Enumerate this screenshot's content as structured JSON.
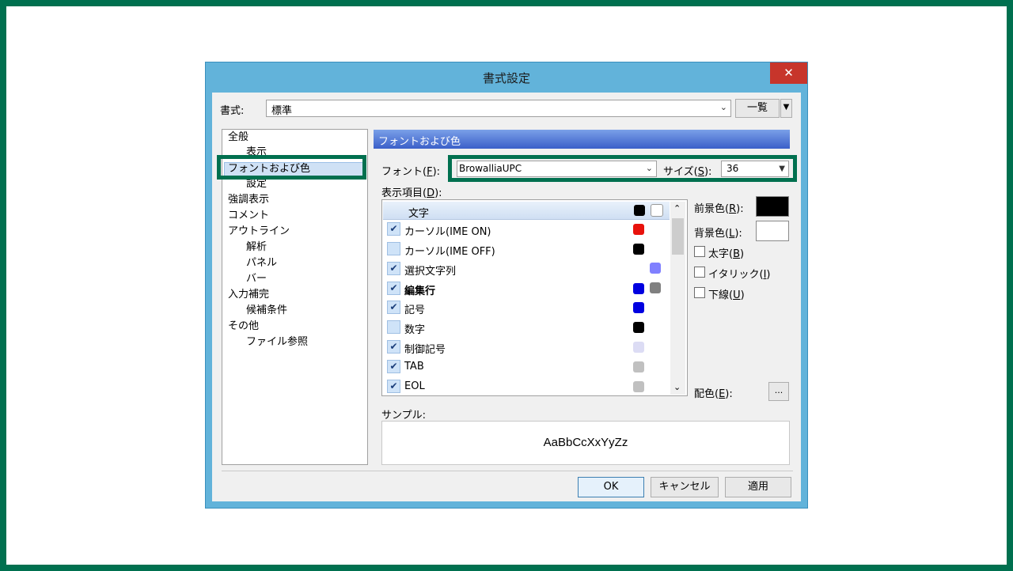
{
  "dialog": {
    "title": "書式設定",
    "close_glyph": "✕",
    "format_label": "書式:",
    "format_value": "標準",
    "list_button": "一覧",
    "tree": [
      {
        "label": "全般",
        "indent": 0
      },
      {
        "label": "表示",
        "indent": 1
      },
      {
        "label": "フォントおよび色",
        "indent": 0,
        "selected": true
      },
      {
        "label": "設定",
        "indent": 1
      },
      {
        "label": "強調表示",
        "indent": 0
      },
      {
        "label": "コメント",
        "indent": 0
      },
      {
        "label": "アウトライン",
        "indent": 0
      },
      {
        "label": "解析",
        "indent": 1
      },
      {
        "label": "パネル",
        "indent": 1
      },
      {
        "label": "バー",
        "indent": 1
      },
      {
        "label": "入力補完",
        "indent": 0
      },
      {
        "label": "候補条件",
        "indent": 1
      },
      {
        "label": "その他",
        "indent": 0
      },
      {
        "label": "ファイル参照",
        "indent": 1
      }
    ],
    "section_title": "フォントおよび色",
    "font_label_pre": "フォント(",
    "font_label_key": "F",
    "font_label_post": "):",
    "font_value": "BrowalliaUPC",
    "size_label_pre": "サイズ(",
    "size_label_key": "S",
    "size_label_post": "):",
    "size_value": "36",
    "items_label_pre": "表示項目(",
    "items_label_key": "D",
    "items_label_post": "):",
    "items_header": "文字",
    "items": [
      {
        "label": "カーソル(IME ON)",
        "checked": true,
        "fg": "#e8120c",
        "bg": null
      },
      {
        "label": "カーソル(IME OFF)",
        "checked": false,
        "fg": "#000000",
        "bg": null
      },
      {
        "label": "選択文字列",
        "checked": true,
        "fg": null,
        "bg": "#8080ff"
      },
      {
        "label": "編集行",
        "checked": true,
        "fg": "#0000e0",
        "bg": "#808080",
        "bold": true
      },
      {
        "label": "記号",
        "checked": true,
        "fg": "#0000e0",
        "bg": null
      },
      {
        "label": "数字",
        "checked": false,
        "fg": "#000000",
        "bg": null
      },
      {
        "label": "制御記号",
        "checked": true,
        "fg": "#dcdcf4",
        "bg": null
      },
      {
        "label": "TAB",
        "checked": true,
        "fg": "#c0c0c0",
        "bg": null
      },
      {
        "label": "EOL",
        "checked": true,
        "fg": "#c0c0c0",
        "bg": null
      }
    ],
    "fg_label_pre": "前景色(",
    "fg_label_key": "R",
    "fg_label_post": "):",
    "bg_label_pre": "背景色(",
    "bg_label_key": "L",
    "bg_label_post": "):",
    "bold_label_pre": "太字(",
    "bold_label_key": "B",
    "bold_label_post": ")",
    "italic_label_pre": "イタリック(",
    "italic_label_key": "I",
    "italic_label_post": ")",
    "underline_label_pre": "下線(",
    "underline_label_key": "U",
    "underline_label_post": ")",
    "scheme_label_pre": "配色(",
    "scheme_label_key": "E",
    "scheme_label_post": "):",
    "scheme_button": "...",
    "sample_label": "サンプル:",
    "sample_text": "AaBbCcXxYyZz",
    "ok_button": "OK",
    "cancel_button": "キャンセル",
    "apply_button": "適用"
  },
  "colors": {
    "frame_border": "#00704f",
    "titlebar": "#62b3da",
    "close_button": "#c7352b",
    "header_swatch_fg": "#000000",
    "header_swatch_bg": "#ffffff",
    "fg_color_button": "#000000",
    "bg_color_button": "#ffffff"
  },
  "icons": {
    "close": "close-icon",
    "dropdown": "chevron-down-icon",
    "check": "checkmark-icon",
    "scroll_up": "scroll-up-arrow-icon",
    "scroll_down": "scroll-down-arrow-icon"
  }
}
